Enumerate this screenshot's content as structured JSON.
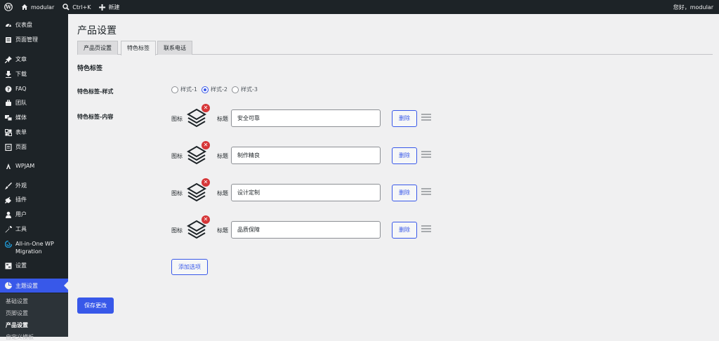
{
  "adminbar": {
    "site_name": "modular",
    "shortcut": "Ctrl+K",
    "new_label": "新建",
    "greeting": "您好，modular"
  },
  "sidebar": {
    "items": [
      {
        "label": "仪表盘",
        "icon": "dashboard-icon"
      },
      {
        "label": "页面管理",
        "icon": "page-manage-icon"
      },
      {
        "label": "文章",
        "icon": "pin-icon"
      },
      {
        "label": "下载",
        "icon": "download-icon"
      },
      {
        "label": "FAQ",
        "icon": "help-icon"
      },
      {
        "label": "团队",
        "icon": "team-icon"
      },
      {
        "label": "媒体",
        "icon": "media-icon"
      },
      {
        "label": "表单",
        "icon": "form-icon"
      },
      {
        "label": "页面",
        "icon": "page-icon"
      },
      {
        "label": "WPJAM",
        "icon": "wpjam-icon"
      },
      {
        "label": "外观",
        "icon": "brush-icon"
      },
      {
        "label": "插件",
        "icon": "plugin-icon"
      },
      {
        "label": "用户",
        "icon": "user-icon"
      },
      {
        "label": "工具",
        "icon": "wrench-icon"
      },
      {
        "label": "All-in-One WP Migration",
        "icon": "migration-icon"
      },
      {
        "label": "设置",
        "icon": "settings-icon"
      },
      {
        "label": "主题设置",
        "icon": "theme-icon"
      }
    ],
    "submenu": [
      "基础设置",
      "页脚设置",
      "产品设置",
      "自定义模板"
    ]
  },
  "main": {
    "title": "产品设置",
    "tabs": [
      "产品页设置",
      "特色标签",
      "联系电话"
    ],
    "active_tab": 1,
    "section_title": "特色标签",
    "style_label": "特色标签-样式",
    "style_options": [
      "样式-1",
      "样式-2",
      "样式-3"
    ],
    "style_selected": 1,
    "content_label": "特色标签-内容",
    "icon_label": "图标",
    "title_label": "标题",
    "rows": [
      {
        "title": "安全可靠"
      },
      {
        "title": "制作精良"
      },
      {
        "title": "设计定制"
      },
      {
        "title": "品质保障"
      }
    ],
    "delete_label": "删除",
    "add_label": "添加选项",
    "save_label": "保存更改"
  },
  "colors": {
    "accent": "#3858e9",
    "sidebar_bg": "#1d2327",
    "danger": "#d63638"
  }
}
